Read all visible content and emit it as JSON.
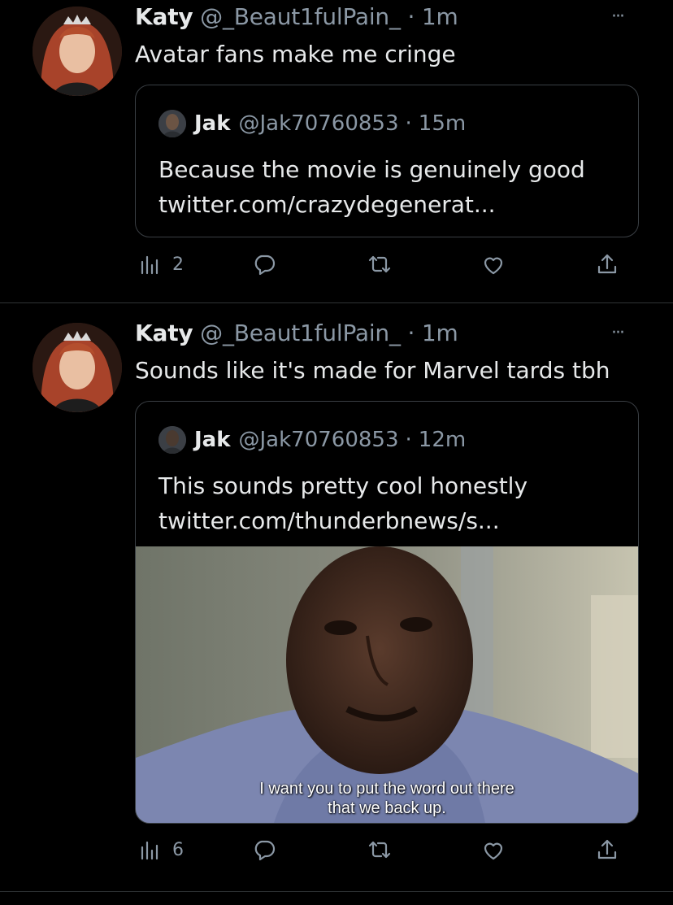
{
  "tweets": [
    {
      "name": "Katy",
      "handle": "@_Beaut1fulPain_",
      "separator": "·",
      "time": "1m",
      "more": "···",
      "text": "Avatar fans make me cringe",
      "quote": {
        "name": "Jak",
        "handle": "@Jak70760853",
        "separator": "·",
        "time": "15m",
        "line1": "Because the movie is genuinely good",
        "line2": "twitter.com/crazydegenerat..."
      },
      "views": "2"
    },
    {
      "name": "Katy",
      "handle": "@_Beaut1fulPain_",
      "separator": "·",
      "time": "1m",
      "more": "···",
      "text": "Sounds like it's made for Marvel tards tbh",
      "quote": {
        "name": "Jak",
        "handle": "@Jak70760853",
        "separator": "·",
        "time": "12m",
        "line1": "This sounds pretty cool honestly",
        "line2": "twitter.com/thunderbnews/s...",
        "media_caption_1": "I want you to put the word out there",
        "media_caption_2": "that we back up."
      },
      "views": "6"
    }
  ],
  "icons": [
    "views-icon",
    "reply-icon",
    "retweet-icon",
    "like-icon",
    "share-icon"
  ],
  "colors": {
    "background": "#000000",
    "text": "#e7e9ea",
    "muted": "#8b98a5",
    "border": "#3a3f44"
  }
}
